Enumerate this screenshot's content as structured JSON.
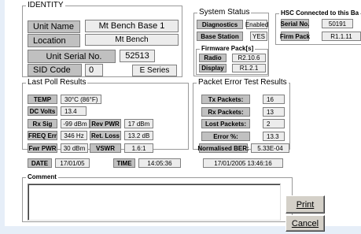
{
  "identity": {
    "title": "IDENTITY",
    "unit_name_label": "Unit Name",
    "unit_name_value": "Mt Bench Base 1",
    "location_label": "Location",
    "location_value": "Mt Bench",
    "serial_label": "Unit Serial No.",
    "serial_value": "52513",
    "sid_label": "SID Code",
    "sid_value": "0",
    "series_value": "E Series"
  },
  "system_status": {
    "title": "System Status",
    "diagnostics_label": "Diagnostics",
    "diagnostics_value": "Enabled",
    "base_station_label": "Base Station",
    "base_station_value": "YES",
    "firmware_title": "Firmware Pack[s]",
    "radio_label": "Radio",
    "radio_value": "R2.10.6",
    "display_label": "Display",
    "display_value": "R1.2.1"
  },
  "hsc": {
    "title": "HSC Connected to this Ba",
    "serial_label": "Serial No.",
    "serial_value": "50191",
    "firm_label": "Firm Pack",
    "firm_value": "R1.1.11"
  },
  "last_poll": {
    "title": "Last Poll Results",
    "temp_label": "TEMP",
    "temp_value": "30°C  (86°F)",
    "dc_label": "DC Volts",
    "dc_value": "13.4",
    "rxsig_label": "Rx Sig",
    "rxsig_value": "-99 dBm",
    "revpwr_label": "Rev PWR",
    "revpwr_value": "17 dBm",
    "freqerr_label": "FREQ Err",
    "freqerr_value": "346 Hz",
    "retloss_label": "Ret. Loss",
    "retloss_value": "13.2 dB",
    "fwdpwr_label": "Fwr PWR",
    "fwdpwr_value": "30 dBm",
    "vswr_label": "VSWR",
    "vswr_value": "1.6:1",
    "date_label": "DATE",
    "date_value": "17/01/05",
    "time_label": "TIME",
    "time_value": "14:05:36"
  },
  "packet_error": {
    "title": "Packet Error Test Results",
    "tx_label": "Tx Packets:",
    "tx_value": "16",
    "rx_label": "Rx Packets:",
    "rx_value": "13",
    "lost_label": "Lost Packets:",
    "lost_value": "2",
    "error_label": "Error %:",
    "error_value": "13.3",
    "ber_label": "Normalised BER:",
    "ber_value": "5.33E-04",
    "timestamp": "17/01/2005  13:46:16"
  },
  "comment": {
    "title": "Comment",
    "value": ""
  },
  "buttons": {
    "print": "Print",
    "cancel": "Cancel"
  }
}
